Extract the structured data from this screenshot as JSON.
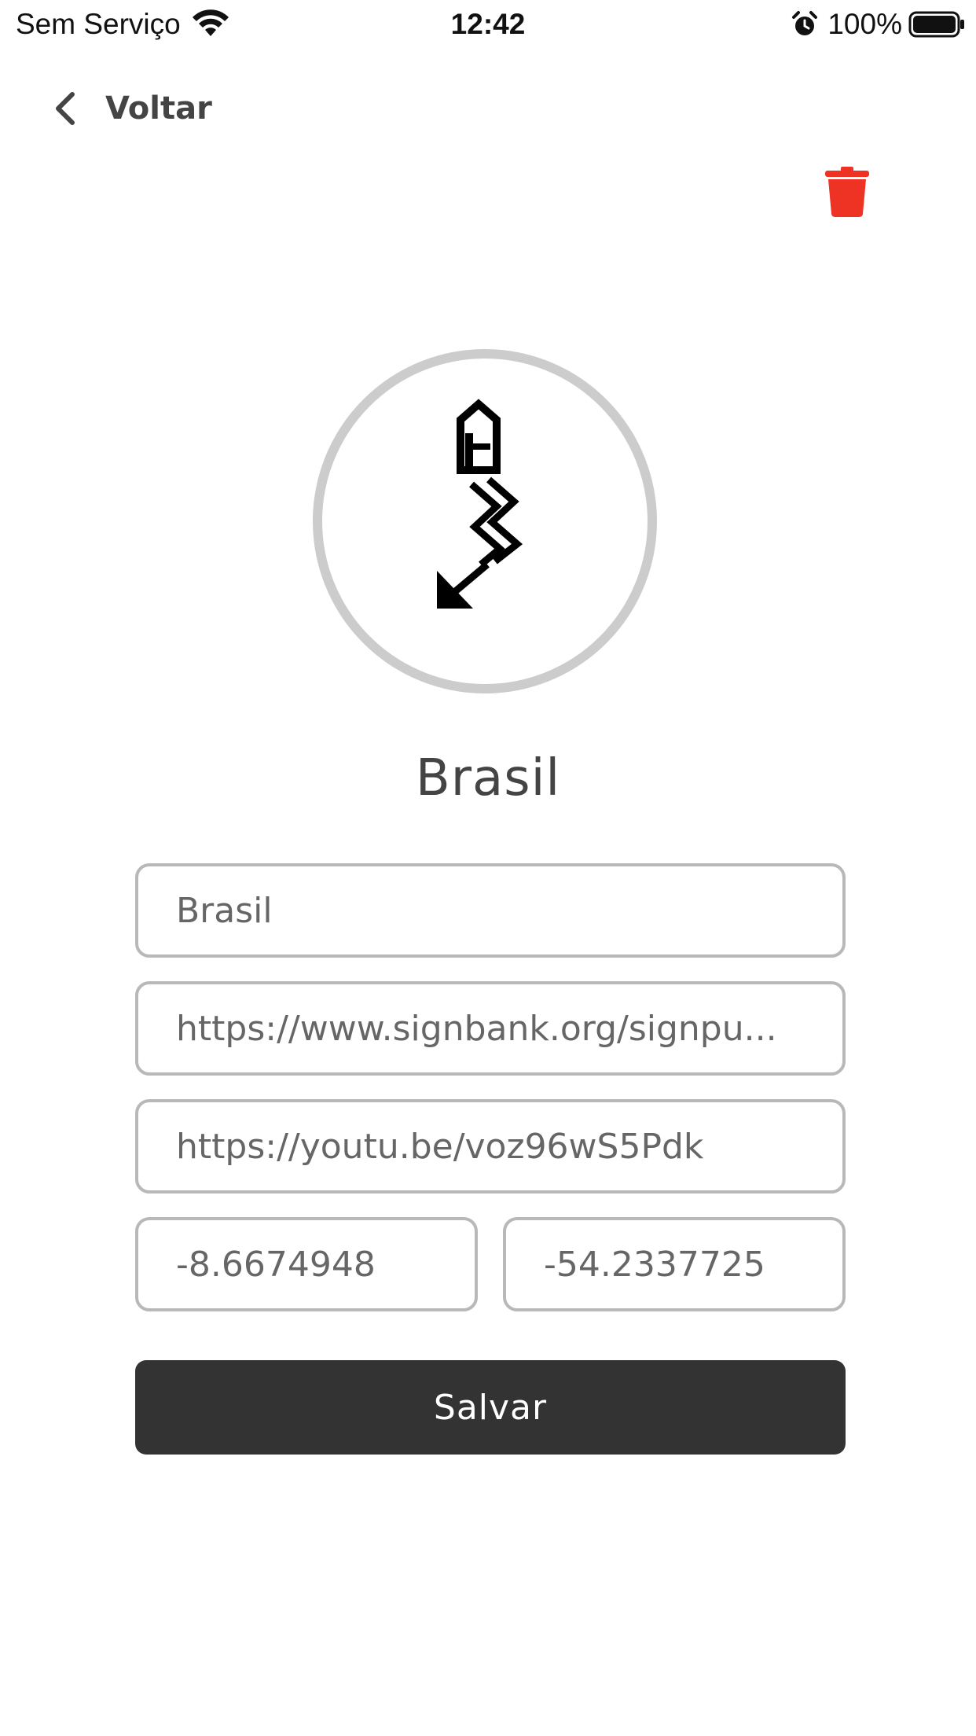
{
  "status_bar": {
    "carrier": "Sem Serviço",
    "time": "12:42",
    "battery_percent": "100%",
    "battery_level": 1.0,
    "wifi_icon": "wifi-icon",
    "alarm_icon": "alarm-clock-icon",
    "battery_icon": "battery-icon"
  },
  "nav": {
    "back_label": "Voltar",
    "back_icon": "chevron-left-icon",
    "delete_icon": "trash-icon"
  },
  "colors": {
    "text": "#444444",
    "delete": "#ee3325",
    "field_border": "#b8b8b8",
    "avatar_border": "#cccccc",
    "button": "#333333",
    "button_text": "#ffffff"
  },
  "avatar": {
    "icon": "signwriting-sign-icon"
  },
  "title": "Brasil",
  "form": {
    "name": "Brasil",
    "sign_url": "https://www.signbank.org/signpuddle2.0/...",
    "sign_url_display": "https://www.signbank.org/signpu...",
    "video_url": "https://youtu.be/voz96wS5Pdk",
    "latitude": "-8.6674948",
    "longitude": "-54.2337725"
  },
  "save_label": "Salvar"
}
